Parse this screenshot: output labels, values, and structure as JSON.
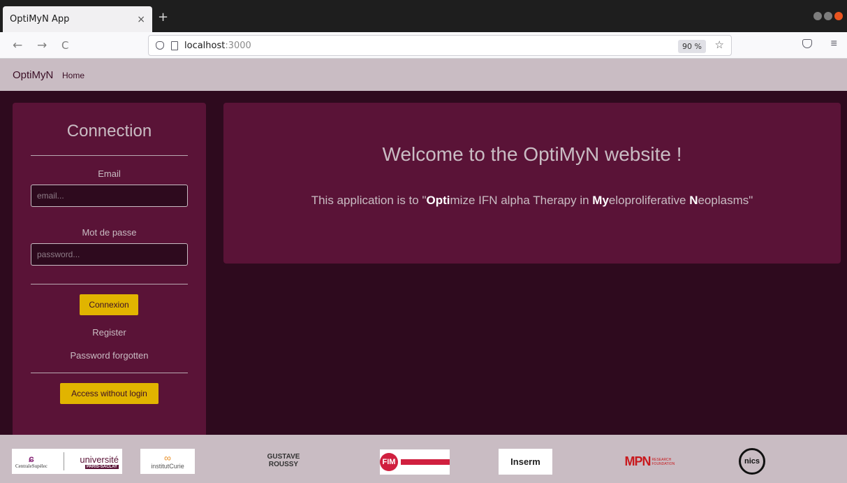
{
  "browser": {
    "tab_title": "OptiMyN App",
    "tab_close": "×",
    "new_tab": "+",
    "url_host": "localhost",
    "url_port": ":3000",
    "zoom": "90 %",
    "back": "←",
    "forward": "→",
    "reload": "C"
  },
  "app_nav": {
    "brand": "OptiMyN",
    "home": "Home"
  },
  "sidebar": {
    "title": "Connection",
    "email_label": "Email",
    "email_placeholder": "email...",
    "password_label": "Mot de passe",
    "password_placeholder": "password...",
    "connect_button": "Connexion",
    "register": "Register",
    "forgot": "Password forgotten",
    "guest_button": "Access without login"
  },
  "welcome": {
    "title": "Welcome to the OptiMyN website !",
    "sub_prefix": "This application is to \"",
    "sub_b1": "Opti",
    "sub_t1": "mize IFN alpha Therapy in ",
    "sub_b2": "My",
    "sub_t2": "eloproliferative ",
    "sub_b3": "N",
    "sub_t3": "eoplasms\""
  },
  "footer_logos": {
    "centrale": "CentraleSupélec",
    "univ": "université",
    "univ_sub": "PARIS-SACLAY",
    "curie": "institutCurie",
    "roussy": "GUSTAVE ROUSSY",
    "fim": "FIM",
    "inserm": "Inserm",
    "mpn": "MPN",
    "mpn_sub": "RESEARCH FOUNDATION",
    "nics": "nics"
  },
  "colors": {
    "panel": "#5a1337",
    "background": "#2e0a1e",
    "accent": "#e1b400",
    "nav": "#c9bcc3"
  }
}
